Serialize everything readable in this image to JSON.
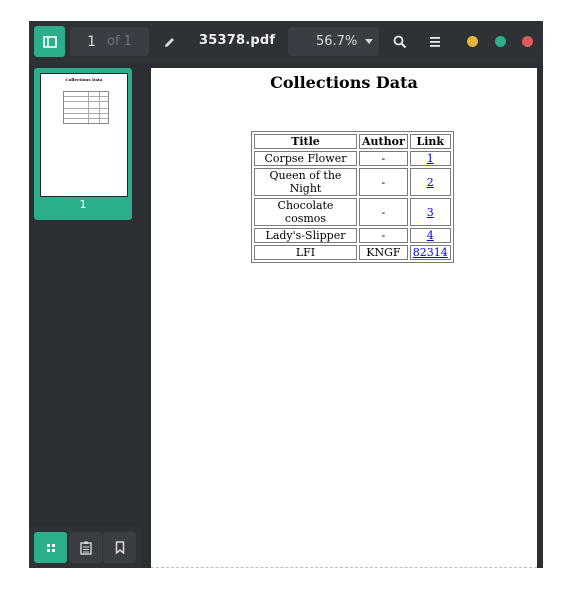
{
  "toolbar": {
    "page_number": "1",
    "page_of": "of 1",
    "file_name": "35378.pdf",
    "zoom": "56.7%"
  },
  "sidebar": {
    "thumbnail_label": "1",
    "thumbnail_heading": "Collections Data"
  },
  "document": {
    "heading": "Collections Data",
    "table": {
      "headers": [
        "Title",
        "Author",
        "Link"
      ],
      "rows": [
        {
          "title": "Corpse Flower",
          "author": "-",
          "link": "1"
        },
        {
          "title": "Queen of the Night",
          "author": "-",
          "link": "2"
        },
        {
          "title": "Chocolate cosmos",
          "author": "-",
          "link": "3"
        },
        {
          "title": "Lady's-Slipper",
          "author": "-",
          "link": "4"
        },
        {
          "title": "LFI",
          "author": "KNGF",
          "link": "82314"
        }
      ]
    }
  },
  "colors": {
    "accent": "#2bae8c",
    "toolbar_bg": "#2e3136",
    "window_bg": "#2b2e33",
    "dot_yellow": "#e6b43a",
    "dot_green": "#2bae8c",
    "dot_red": "#e05a5d"
  },
  "icons": {
    "sidebar_toggle": "sidebar-icon",
    "edit": "pencil-icon",
    "search": "search-icon",
    "menu": "hamburger-icon",
    "thumbnails": "grid-icon",
    "outline": "clipboard-icon",
    "bookmarks": "bookmark-icon"
  }
}
